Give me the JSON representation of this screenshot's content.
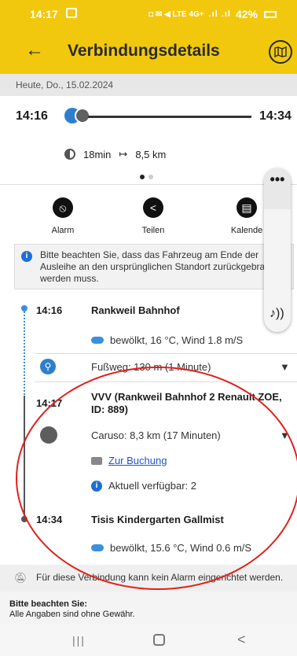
{
  "status_bar": {
    "time": "14:17",
    "indicators": "◘ ✉ ◀ LTE 4G+",
    "signal": ".ıl .ıl",
    "battery": "42%"
  },
  "app_bar": {
    "title": "Verbindungsdetails",
    "back_icon": "arrow-back-icon",
    "map_icon": "map-icon"
  },
  "date": "Heute, Do., 15.02.2024",
  "summary": {
    "departure": "14:16",
    "arrival": "14:34",
    "duration": "18min",
    "distance_icon": "↦",
    "distance": "8,5 km"
  },
  "actions": [
    {
      "label": "Alarm",
      "icon": "alarm-off-icon",
      "glyph": "⦸"
    },
    {
      "label": "Teilen",
      "icon": "share-icon",
      "glyph": "<"
    },
    {
      "label": "Kalende",
      "icon": "calendar-icon",
      "glyph": "▤"
    }
  ],
  "info_notice": "Bitte beachten Sie, dass das Fahrzeug am Ende der Ausleihe an den ursprünglichen Standort zurückgebracht werden muss.",
  "float_panel": {
    "menu_glyph": "•••",
    "audio_glyph": "♪))"
  },
  "timeline": {
    "start": {
      "time": "14:16",
      "name": "Rankweil Bahnhof",
      "weather": "bewölkt, 16 °C, Wind 1.8 m/S"
    },
    "walk": {
      "text": "Fußweg: 130 m (1 Minute)"
    },
    "carshare": {
      "time": "14:17",
      "name": "VVV (Rankweil Bahnhof 2 Renault ZOE, ID: 889)",
      "detail": "Caruso: 8,3 km (17 Minuten)",
      "booking": "Zur Buchung",
      "available": "Aktuell verfügbar: 2"
    },
    "end": {
      "time": "14:34",
      "name": "Tisis Kindergarten Gallmist",
      "weather": "bewölkt, 15.6 °C, Wind 0.6 m/S"
    }
  },
  "alarm_note": "Für diese Verbindung kann kein Alarm eingerichtet werden.",
  "disclaimer": {
    "title": "Bitte beachten Sie:",
    "text": "Alle Angaben sind ohne Gewähr."
  },
  "nav": {
    "recents": "|||",
    "back": "<"
  },
  "colors": {
    "accent": "#f2c80f",
    "walk": "#2d7fce",
    "link": "#1f55c7",
    "annotation": "#e0201c"
  }
}
